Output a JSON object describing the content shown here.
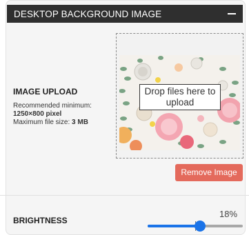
{
  "header": {
    "title": "DESKTOP BACKGROUND IMAGE",
    "collapse_icon": "minus-icon"
  },
  "image_upload": {
    "section_title": "IMAGE UPLOAD",
    "recommended_label": "Recommended minimum:",
    "recommended_size": "1250×800 pixel",
    "max_size_label": "Maximum file size:",
    "max_size_value": "3 MB",
    "dropzone_label": "Drop files here to upload",
    "remove_button_label": "Remove Image"
  },
  "brightness": {
    "label": "BRIGHTNESS",
    "value_text": "18%",
    "value": 0.55,
    "accent_color": "#1a73e8"
  },
  "colors": {
    "header_bg": "#2f2f2f",
    "remove_button": "#e46a5c"
  }
}
